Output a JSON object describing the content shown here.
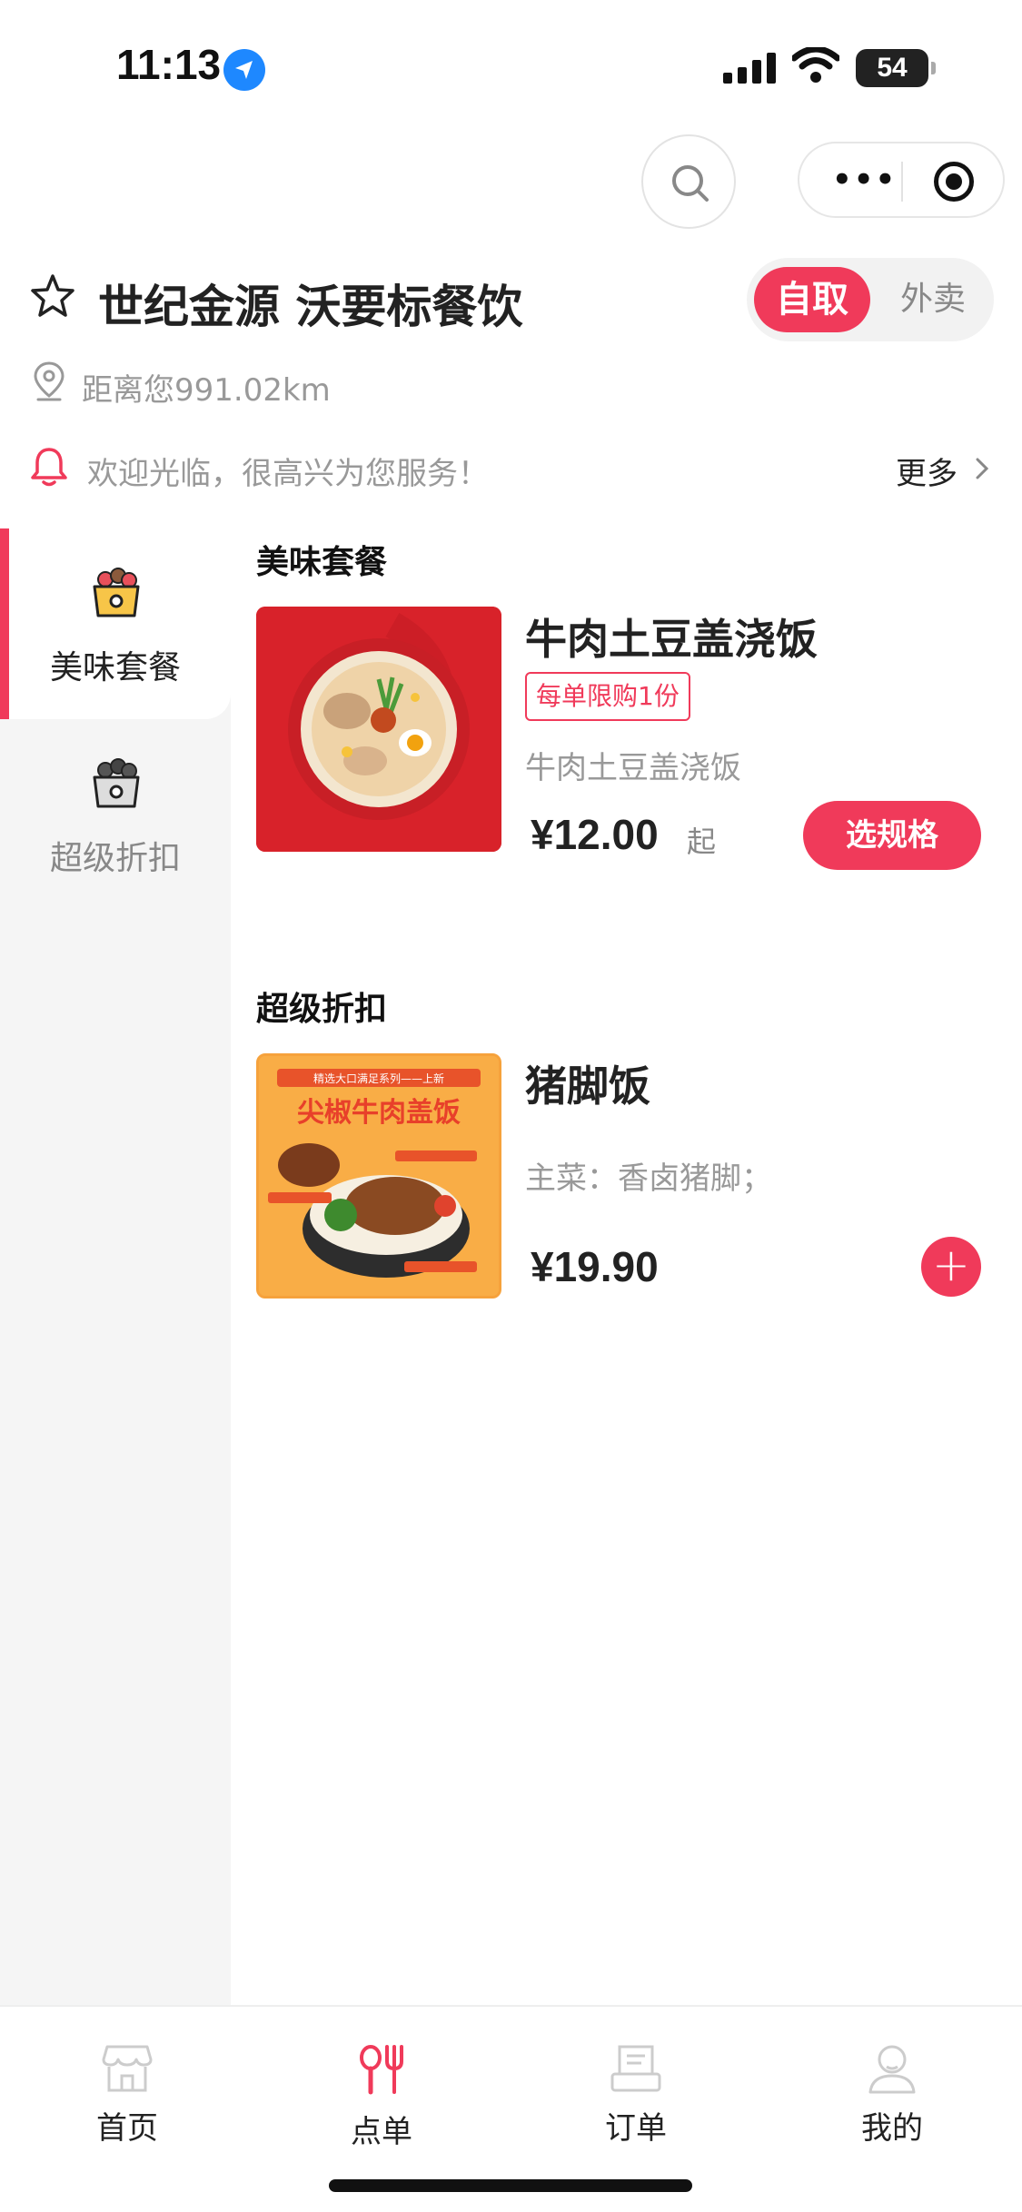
{
  "status_bar": {
    "time": "11:13",
    "battery": "54"
  },
  "store": {
    "name": "世纪金源 沃要标餐饮",
    "distance": "距离您991.02km",
    "notice": "欢迎光临，很高兴为您服务！",
    "more_label": "更多",
    "mode_self": "自取",
    "mode_delivery": "外卖"
  },
  "sidebar": {
    "items": [
      {
        "label": "美味套餐",
        "active": true
      },
      {
        "label": "超级折扣",
        "active": false
      }
    ]
  },
  "sections": [
    {
      "title": "美味套餐",
      "products": [
        {
          "name": "牛肉土豆盖浇饭",
          "tag": "每单限购1份",
          "desc": "牛肉土豆盖浇饭",
          "price": "¥12.00",
          "price_suffix": "起",
          "action": "选规格"
        }
      ]
    },
    {
      "title": "超级折扣",
      "products": [
        {
          "name": "猪脚饭",
          "desc": "主菜：香卤猪脚；",
          "price": "¥19.90",
          "action": "+"
        }
      ]
    }
  ],
  "poster_text": {
    "banner": "精选大口满足系列——上新",
    "headline": "尖椒牛肉盖饭"
  },
  "tabbar": {
    "items": [
      {
        "label": "首页"
      },
      {
        "label": "点单"
      },
      {
        "label": "订单"
      },
      {
        "label": "我的"
      }
    ]
  },
  "colors": {
    "accent": "#f03a5a",
    "sidebar_bg": "#f5f5f5",
    "muted_text": "#999999"
  }
}
